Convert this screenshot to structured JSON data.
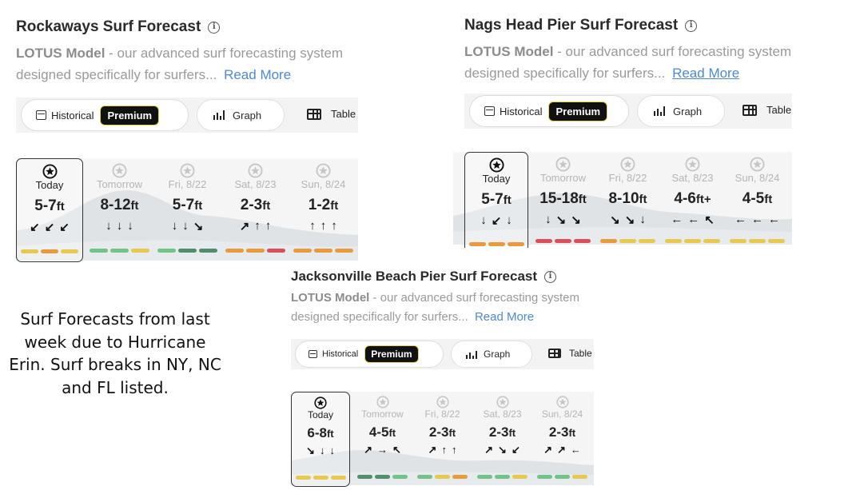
{
  "colors": {
    "good": "#72c486",
    "fair": "#e7c94f",
    "fairgood": "#4f8f6b",
    "poor": "#e89a3c",
    "bad": "#d9505b"
  },
  "common": {
    "model": "LOTUS Model",
    "desc1": " - our advanced surf forecasting system",
    "desc2": "designed specifically for surfers...",
    "read_more": "Read More",
    "historical": "Historical",
    "premium": "Premium",
    "graph": "Graph",
    "table": "Table",
    "unit": "ft"
  },
  "panels": [
    {
      "title": "Rockaways Surf Forecast",
      "days": [
        {
          "label": "Today",
          "height": "5-7",
          "arrows": [
            "↙",
            "↙",
            "↙"
          ],
          "bars": [
            "fair",
            "poor",
            "fair"
          ]
        },
        {
          "label": "Tomorrow",
          "height": "8-12",
          "arrows": [
            "↓",
            "↓",
            "↓"
          ],
          "bars": [
            "good",
            "good",
            "fair"
          ]
        },
        {
          "label": "Fri, 8/22",
          "height": "5-7",
          "arrows": [
            "↓",
            "↓",
            "↘"
          ],
          "bars": [
            "good",
            "fairgood",
            "fairgood"
          ]
        },
        {
          "label": "Sat, 8/23",
          "height": "2-3",
          "arrows": [
            "↗",
            "↑",
            "↑"
          ],
          "bars": [
            "poor",
            "poor",
            "bad"
          ]
        },
        {
          "label": "Sun, 8/24",
          "height": "1-2",
          "arrows": [
            "↑",
            "↑",
            "↑"
          ],
          "bars": [
            "poor",
            "poor",
            "poor"
          ]
        }
      ]
    },
    {
      "title": "Nags Head Pier Surf Forecast",
      "days": [
        {
          "label": "Today",
          "height": "5-7",
          "arrows": [
            "↓",
            "↙",
            "↓"
          ],
          "bars": [
            "poor",
            "poor",
            "poor"
          ]
        },
        {
          "label": "Tomorrow",
          "height": "15-18",
          "arrows": [
            "↓",
            "↘",
            "↘"
          ],
          "bars": [
            "bad",
            "bad",
            "bad"
          ]
        },
        {
          "label": "Fri, 8/22",
          "height": "8-10",
          "arrows": [
            "↘",
            "↘",
            "↓"
          ],
          "bars": [
            "poor",
            "fair",
            "fair"
          ]
        },
        {
          "label": "Sat, 8/23",
          "height": "4-6",
          "unit_suffix": "+",
          "arrows": [
            "←",
            "←",
            "↖"
          ],
          "bars": [
            "fair",
            "fair",
            "fair"
          ]
        },
        {
          "label": "Sun, 8/24",
          "height": "4-5",
          "arrows": [
            "←",
            "←",
            "←"
          ],
          "bars": [
            "fair",
            "fair",
            "fair"
          ]
        }
      ]
    },
    {
      "title": "Jacksonville Beach Pier Surf Forecast",
      "days": [
        {
          "label": "Today",
          "height": "6-8",
          "arrows": [
            "↘",
            "↓",
            "↓"
          ],
          "bars": [
            "fair",
            "fair",
            "fair"
          ]
        },
        {
          "label": "Tomorrow",
          "height": "4-5",
          "arrows": [
            "↗",
            "→",
            "↖"
          ],
          "bars": [
            "fairgood",
            "fairgood",
            "good"
          ]
        },
        {
          "label": "Fri, 8/22",
          "height": "2-3",
          "arrows": [
            "↗",
            "↑",
            "↑"
          ],
          "bars": [
            "good",
            "fair",
            "poor"
          ]
        },
        {
          "label": "Sat, 8/23",
          "height": "2-3",
          "arrows": [
            "↗",
            "↘",
            "↙"
          ],
          "bars": [
            "good",
            "good",
            "fair"
          ]
        },
        {
          "label": "Sun, 8/24",
          "height": "2-3",
          "arrows": [
            "↗",
            "↗",
            "←"
          ],
          "bars": [
            "good",
            "good",
            "fair"
          ]
        }
      ]
    }
  ],
  "caption": "Surf Forecasts from last week due to Hurricane Erin. Surf breaks in NY, NC and FL listed."
}
